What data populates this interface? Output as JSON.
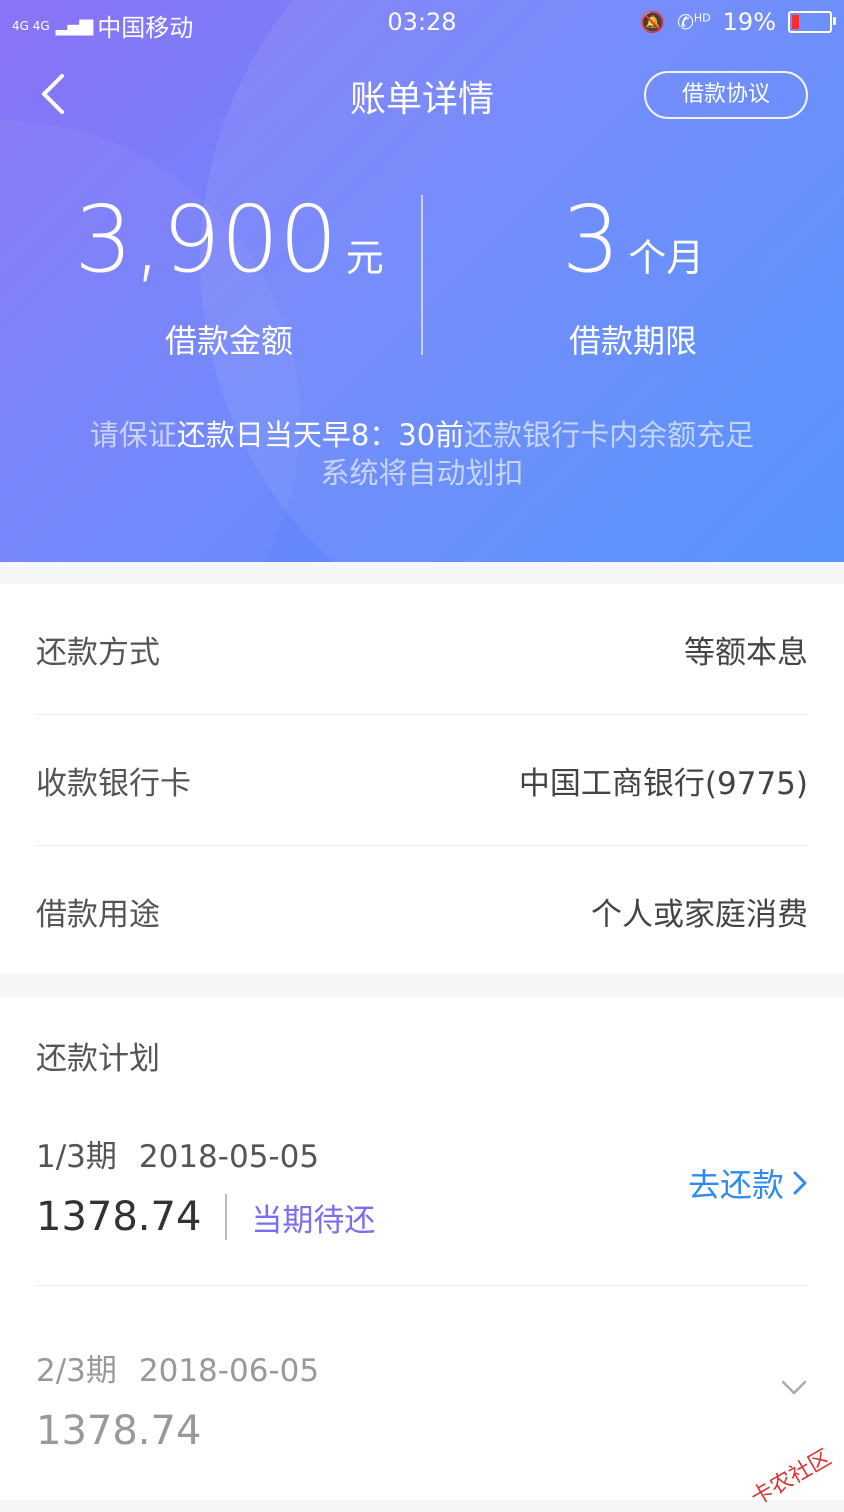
{
  "status_bar": {
    "network": "4G 4G",
    "carrier": "中国移动",
    "time": "03:28",
    "hd": "HD",
    "battery": "19%",
    "battery_level": 0.19,
    "battery_color": "#ff2a2a"
  },
  "header": {
    "title": "账单详情",
    "agreement_label": "借款协议",
    "loan_amount": "3,900",
    "loan_amount_unit": "元",
    "loan_amount_caption": "借款金额",
    "loan_term": "3",
    "loan_term_unit": "个月",
    "loan_term_caption": "借款期限",
    "notice": {
      "part1": "请保证",
      "highlight": "还款日当天早8：30前",
      "part2": "还款银行卡内余额充足",
      "line2": "系统将自动划扣"
    },
    "gradient_colors": [
      "#8a73f6",
      "#4b8cfb"
    ]
  },
  "info": {
    "rows": [
      {
        "label": "还款方式",
        "value": "等额本息"
      },
      {
        "label": "收款银行卡",
        "value": "中国工商银行(9775)"
      },
      {
        "label": "借款用途",
        "value": "个人或家庭消费"
      }
    ]
  },
  "plan": {
    "title": "还款计划",
    "installments": [
      {
        "period": "1/3期",
        "date": "2018-05-05",
        "amount": "1378.74",
        "status": "当期待还",
        "action": "去还款"
      },
      {
        "period": "2/3期",
        "date": "2018-06-05",
        "amount": "1378.74"
      }
    ],
    "status_color": "#7a6ef0",
    "action_color": "#2f8bf0"
  },
  "watermark": "卡农社区"
}
